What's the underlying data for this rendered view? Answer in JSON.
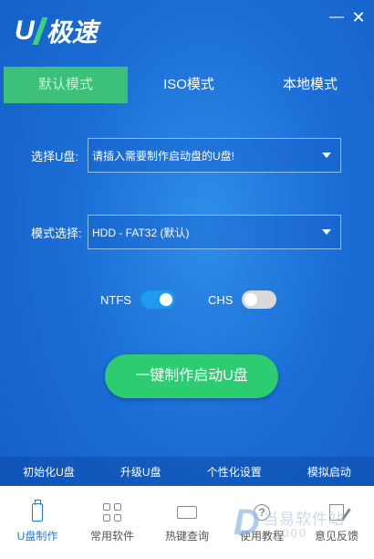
{
  "app": {
    "brand_letter": "U",
    "brand_name": "极速",
    "minimize_symbol": "—",
    "close_symbol": "✕"
  },
  "tabs": [
    {
      "label": "默认模式",
      "active": true
    },
    {
      "label": "ISO模式",
      "active": false
    },
    {
      "label": "本地模式",
      "active": false
    }
  ],
  "usb_select": {
    "label": "选择U盘:",
    "value": "请插入需要制作启动盘的U盘!"
  },
  "mode_select": {
    "label": "模式选择:",
    "value": "HDD - FAT32 (默认)"
  },
  "toggles": {
    "ntfs": {
      "label": "NTFS",
      "on": true
    },
    "chs": {
      "label": "CHS",
      "on": false
    }
  },
  "start_button": "一键制作启动U盘",
  "functions": [
    "初始化U盘",
    "升级U盘",
    "个性化设置",
    "模拟启动"
  ],
  "bottom_nav": [
    {
      "label": "U盘制作",
      "icon": "usb-drive-icon",
      "active": true
    },
    {
      "label": "常用软件",
      "icon": "apps-grid-icon",
      "active": false
    },
    {
      "label": "热键查询",
      "icon": "keyboard-icon",
      "active": false
    },
    {
      "label": "使用教程",
      "icon": "help-icon",
      "active": false
    },
    {
      "label": "意见反馈",
      "icon": "feedback-edit-icon",
      "active": false
    }
  ],
  "watermark": {
    "logo": "D",
    "text": "当易软件站",
    "sub": "1000"
  },
  "colors": {
    "accent_green": "#2ecc71",
    "background_blue": "#1b6ed6",
    "toggle_on": "#1e9af0",
    "active_nav": "#1e7ee0"
  }
}
